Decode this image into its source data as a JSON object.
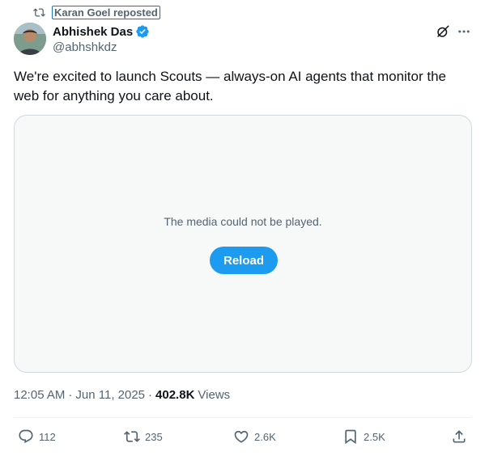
{
  "repost": {
    "icon": "repost-icon",
    "label": "Karan Goel reposted"
  },
  "author": {
    "name": "Abhishek Das",
    "handle": "@abhshkdz",
    "verified": true,
    "avatar_icon": "avatar"
  },
  "header_actions": {
    "grok_icon": "grok-icon",
    "more_icon": "more-icon"
  },
  "tweet": {
    "text": "We're excited to launch Scouts — always-on AI agents that monitor the web for anything you care about."
  },
  "media": {
    "message": "The media could not be played.",
    "reload_label": "Reload"
  },
  "meta": {
    "time": "12:05 AM",
    "date": "Jun 11, 2025",
    "views_count": "402.8K",
    "views_label": "Views",
    "separator": "·"
  },
  "actions": {
    "replies": "112",
    "reposts": "235",
    "likes": "2.6K",
    "bookmarks": "2.5K"
  },
  "colors": {
    "accent": "#1d9bf0",
    "text_primary": "#0f1419",
    "text_secondary": "#536471",
    "border": "#cfd9de",
    "media_bg": "#f7f8f8"
  }
}
